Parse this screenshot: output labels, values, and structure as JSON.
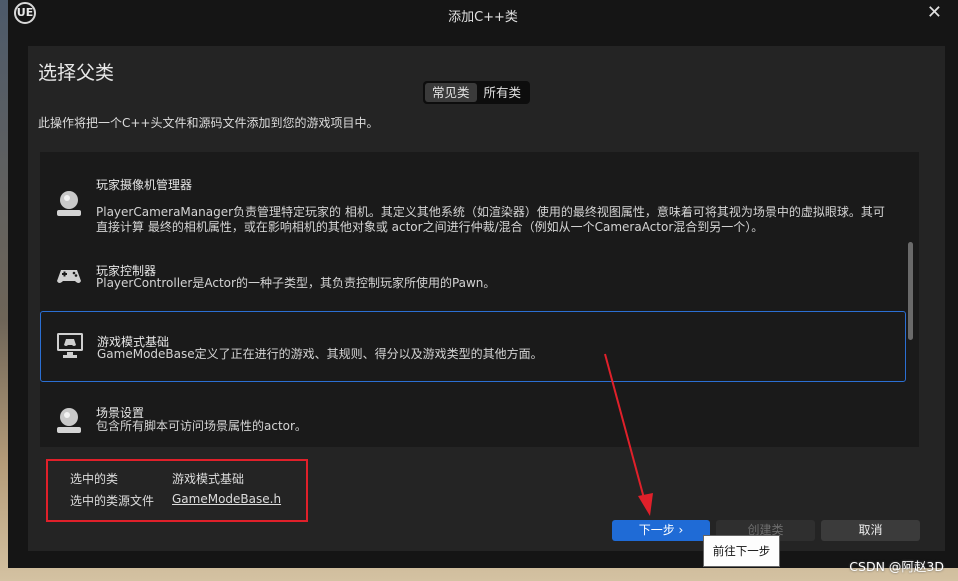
{
  "window": {
    "title": "添加C++类",
    "logo": "UE",
    "close_glyph": "✕"
  },
  "dialog": {
    "heading": "选择父类",
    "tabs": [
      {
        "label": "常见类",
        "active": true
      },
      {
        "label": "所有类",
        "active": false
      }
    ],
    "description": "此操作将把一个C++头文件和源码文件添加到您的游戏项目中。",
    "classes": [
      {
        "name": "玩家摄像机管理器",
        "desc": "PlayerCameraManager负责管理特定玩家的 相机。其定义其他系统（如渲染器）使用的最终视图属性，意味着可将其视为场景中的虚拟眼球。其可直接计算 最终的相机属性，或在影响相机的其他对象或 actor之间进行仲裁/混合（例如从一个CameraActor混合到另一个）。",
        "icon": "camera-manager-icon",
        "selected": false
      },
      {
        "name": "玩家控制器",
        "desc": "PlayerController是Actor的一种子类型，其负责控制玩家所使用的Pawn。",
        "icon": "gamepad-icon",
        "selected": false
      },
      {
        "name": "游戏模式基础",
        "desc": "GameModeBase定义了正在进行的游戏、其规则、得分以及游戏类型的其他方面。",
        "icon": "monitor-gamepad-icon",
        "selected": true
      },
      {
        "name": "场景设置",
        "desc": "包含所有脚本可访问场景属性的actor。",
        "icon": "world-settings-icon",
        "selected": false
      }
    ],
    "selection": {
      "class_label": "选中的类",
      "class_value": "游戏模式基础",
      "file_label": "选中的类源文件",
      "file_value": "GameModeBase.h"
    },
    "buttons": {
      "next": "下一步 ›",
      "create": "创建类",
      "cancel": "取消"
    },
    "tooltip": "前往下一步"
  },
  "watermark": "CSDN @阿赵3D",
  "colors": {
    "accent": "#1f6bd6",
    "annotation": "#e0202a",
    "selected_border": "#2b6fd3"
  }
}
